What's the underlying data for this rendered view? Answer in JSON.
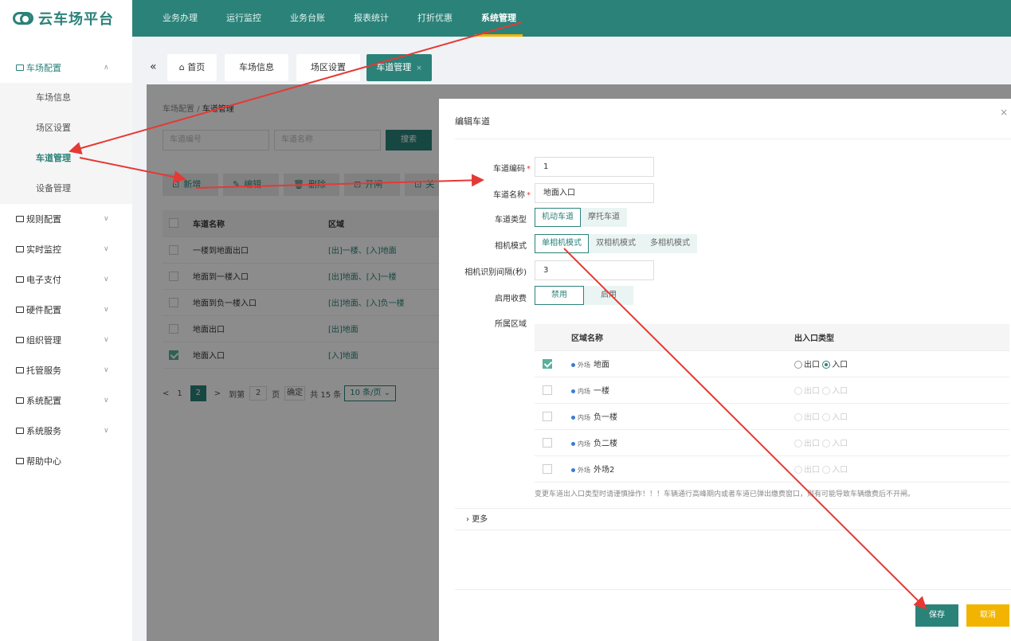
{
  "brand": {
    "name": "云车场平台"
  },
  "topnav": [
    "业务办理",
    "运行监控",
    "业务台账",
    "报表统计",
    "打折优惠",
    "系统管理"
  ],
  "sidebar": {
    "group_open": "车场配置",
    "subitems": [
      "车场信息",
      "场区设置",
      "车道管理",
      "设备管理"
    ],
    "groups": [
      "规则配置",
      "实时监控",
      "电子支付",
      "硬件配置",
      "组织管理",
      "托管服务",
      "系统配置",
      "系统服务",
      "帮助中心"
    ]
  },
  "tabs": {
    "home": "首页",
    "t1": "车场信息",
    "t2": "场区设置",
    "t3": "车道管理",
    "close": "×"
  },
  "breadcrumb": {
    "parent": "车场配置",
    "sep": "/",
    "current": "车道管理"
  },
  "search": {
    "code_placeholder": "车道编号",
    "name_placeholder": "车道名称",
    "button": "搜索"
  },
  "toolbar": {
    "add": "新增",
    "edit": "编辑",
    "delete": "删除",
    "open": "开闸",
    "close": "关"
  },
  "table": {
    "headers": [
      "车道名称",
      "区域"
    ],
    "rows": [
      {
        "name": "一楼到地面出口",
        "area": "[出]一楼、[入]地面"
      },
      {
        "name": "地面到一楼入口",
        "area": "[出]地面、[入]一楼"
      },
      {
        "name": "地面到负一楼入口",
        "area": "[出]地面、[入]负一楼"
      },
      {
        "name": "地面出口",
        "area": "[出]地面"
      },
      {
        "name": "地面入口",
        "area": "[入]地面"
      }
    ]
  },
  "pager": {
    "prev": "<",
    "p1": "1",
    "p2": "2",
    "next": ">",
    "goto": "到第",
    "page_input": "2",
    "page_unit": "页",
    "confirm": "确定",
    "total": "共 15 条",
    "size": "10 条/页"
  },
  "modal": {
    "title": "编辑车道",
    "close": "×",
    "fields": {
      "code_label": "车道编码",
      "code_value": "1",
      "name_label": "车道名称",
      "name_value": "地面入口",
      "type_label": "车道类型",
      "type_opts": [
        "机动车道",
        "摩托车道"
      ],
      "camera_label": "相机模式",
      "camera_opts": [
        "单相机模式",
        "双相机模式",
        "多相机模式"
      ],
      "interval_label": "相机识别间隔(秒)",
      "interval_value": "3",
      "fee_label": "启用收费",
      "fee_opts": [
        "禁用",
        "启用"
      ],
      "zone_label": "所属区域",
      "required": "*"
    },
    "zone_table": {
      "headers": [
        "区域名称",
        "出入口类型"
      ],
      "rows": [
        {
          "tag": "外场",
          "name": "地面",
          "checked": true
        },
        {
          "tag": "内场",
          "name": "一楼",
          "checked": false
        },
        {
          "tag": "内场",
          "name": "负一楼",
          "checked": false
        },
        {
          "tag": "内场",
          "name": "负二楼",
          "checked": false
        },
        {
          "tag": "外场",
          "name": "外场2",
          "checked": false
        }
      ],
      "out": "出口",
      "in": "入口"
    },
    "warning": "变更车道出入口类型时请谨慎操作！！！车辆通行高峰期内或者车道已弹出缴费窗口，则有可能导致车辆缴费后不开闸。",
    "more": "更多",
    "save": "保存",
    "cancel": "取消"
  },
  "colors": {
    "primary": "#2b8279",
    "accent": "#f2b400",
    "arrow": "#e53935"
  }
}
